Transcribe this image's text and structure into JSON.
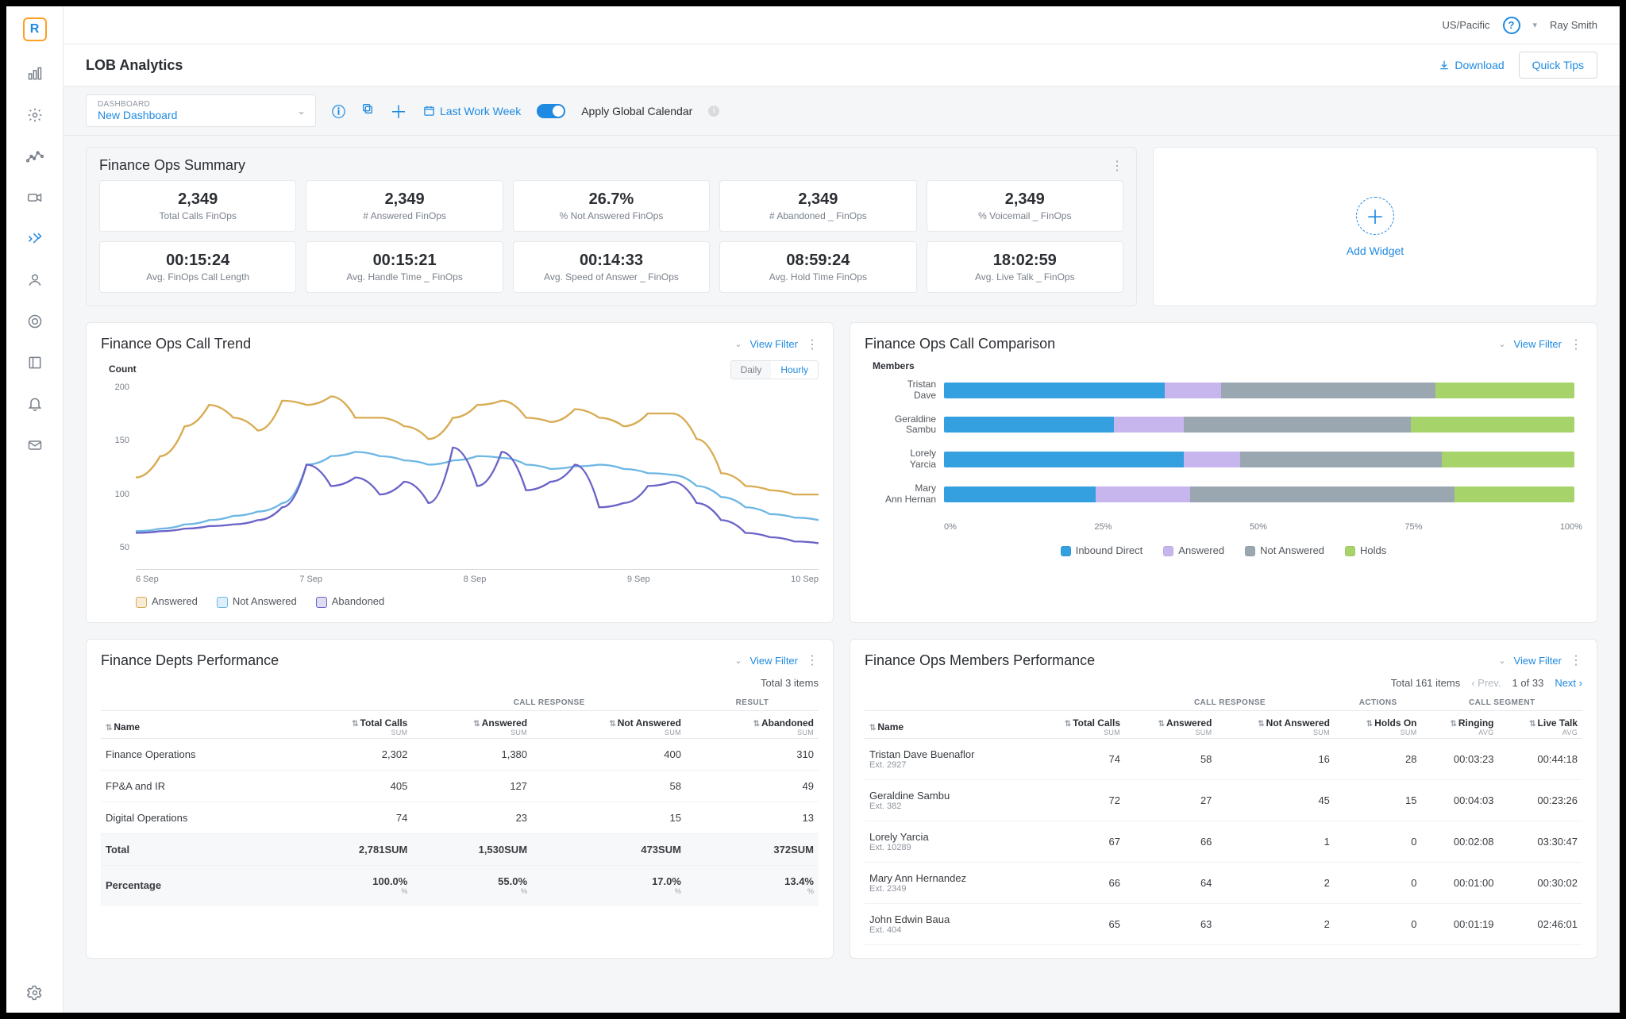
{
  "header": {
    "timezone": "US/Pacific",
    "user": "Ray Smith",
    "page_title": "LOB Analytics",
    "download": "Download",
    "quick_tips": "Quick Tips"
  },
  "toolbar": {
    "dashboard_label": "DASHBOARD",
    "dashboard_value": "New Dashboard",
    "date_label": "Last Work Week",
    "toggle_label": "Apply Global Calendar"
  },
  "add_widget": "Add Widget",
  "summary": {
    "title": "Finance Ops Summary",
    "kpis": [
      {
        "value": "2,349",
        "label": "Total Calls FinOps"
      },
      {
        "value": "2,349",
        "label": "# Answered FinOps"
      },
      {
        "value": "26.7%",
        "label": "% Not Answered FinOps"
      },
      {
        "value": "2,349",
        "label": "# Abandoned _ FinOps"
      },
      {
        "value": "2,349",
        "label": "% Voicemail _ FinOps"
      },
      {
        "value": "00:15:24",
        "label": "Avg. FinOps Call Length"
      },
      {
        "value": "00:15:21",
        "label": "Avg. Handle Time _ FinOps"
      },
      {
        "value": "00:14:33",
        "label": "Avg. Speed of Answer _ FinOps"
      },
      {
        "value": "08:59:24",
        "label": "Avg. Hold Time FinOps"
      },
      {
        "value": "18:02:59",
        "label": "Avg. Live Talk _ FinOps"
      }
    ]
  },
  "trend": {
    "title": "Finance Ops Call Trend",
    "view_filter": "View Filter",
    "ylabel": "Count",
    "daily": "Daily",
    "hourly": "Hourly",
    "legend": [
      "Answered",
      "Not Answered",
      "Abandoned"
    ]
  },
  "compare": {
    "title": "Finance Ops Call Comparison",
    "view_filter": "View Filter",
    "ylabel": "Members",
    "legend": [
      "Inbound Direct",
      "Answered",
      "Not Answered",
      "Holds"
    ]
  },
  "depts": {
    "title": "Finance Depts Performance",
    "view_filter": "View Filter",
    "total_items": "Total 3 items",
    "group_response": "CALL RESPONSE",
    "group_result": "RESULT",
    "cols": {
      "name": "Name",
      "total": "Total Calls",
      "ans": "Answered",
      "nans": "Not Answered",
      "aband": "Abandoned"
    },
    "sub_sum": "SUM",
    "sub_pct": "%",
    "rows": [
      {
        "name": "Finance Operations",
        "total": "2,302",
        "ans": "1,380",
        "nans": "400",
        "aband": "310"
      },
      {
        "name": "FP&A and IR",
        "total": "405",
        "ans": "127",
        "nans": "58",
        "aband": "49"
      },
      {
        "name": "Digital Operations",
        "total": "74",
        "ans": "23",
        "nans": "15",
        "aband": "13"
      }
    ],
    "total_row": {
      "name": "Total",
      "total": "2,781",
      "ans": "1,530",
      "nans": "473",
      "aband": "372"
    },
    "pct_row": {
      "name": "Percentage",
      "total": "100.0%",
      "ans": "55.0%",
      "nans": "17.0%",
      "aband": "13.4%"
    }
  },
  "members": {
    "title": "Finance Ops Members Performance",
    "view_filter": "View Filter",
    "total_items": "Total 161 items",
    "prev": "Prev.",
    "page": "1 of 33",
    "next": "Next",
    "group_response": "CALL RESPONSE",
    "group_actions": "ACTIONS",
    "group_segment": "CALL SEGMENT",
    "cols": {
      "name": "Name",
      "total": "Total Calls",
      "ans": "Answered",
      "nans": "Not Answered",
      "holds": "Holds On",
      "ring": "Ringing",
      "live": "Live Talk"
    },
    "sub_sum": "SUM",
    "sub_avg": "AVG",
    "rows": [
      {
        "name": "Tristan Dave Buenaflor",
        "ext": "Ext. 2927",
        "total": "74",
        "ans": "58",
        "nans": "16",
        "holds": "28",
        "ring": "00:03:23",
        "live": "00:44:18"
      },
      {
        "name": "Geraldine Sambu",
        "ext": "Ext. 382",
        "total": "72",
        "ans": "27",
        "nans": "45",
        "holds": "15",
        "ring": "00:04:03",
        "live": "00:23:26"
      },
      {
        "name": "Lorely Yarcia",
        "ext": "Ext. 10289",
        "total": "67",
        "ans": "66",
        "nans": "1",
        "holds": "0",
        "ring": "00:02:08",
        "live": "03:30:47"
      },
      {
        "name": "Mary Ann Hernandez",
        "ext": "Ext. 2349",
        "total": "66",
        "ans": "64",
        "nans": "2",
        "holds": "0",
        "ring": "00:01:00",
        "live": "00:30:02"
      },
      {
        "name": "John Edwin Baua",
        "ext": "Ext. 404",
        "total": "65",
        "ans": "63",
        "nans": "2",
        "holds": "0",
        "ring": "00:01:19",
        "live": "02:46:01"
      }
    ]
  },
  "chart_data": [
    {
      "type": "line",
      "title": "Finance Ops Call Trend",
      "ylabel": "Count",
      "ylim": [
        0,
        220
      ],
      "x_ticks": [
        "6 Sep",
        "7 Sep",
        "8 Sep",
        "9 Sep",
        "10 Sep"
      ],
      "series": [
        {
          "name": "Answered",
          "color": "#d9ab52",
          "values": [
            105,
            130,
            165,
            190,
            175,
            160,
            195,
            190,
            200,
            175,
            175,
            165,
            150,
            175,
            190,
            195,
            175,
            170,
            185,
            175,
            165,
            180,
            180,
            150,
            110,
            95,
            90,
            85,
            85
          ]
        },
        {
          "name": "Not Answered",
          "color": "#6db7e4",
          "values": [
            42,
            45,
            50,
            55,
            60,
            65,
            75,
            120,
            130,
            135,
            130,
            125,
            120,
            125,
            130,
            128,
            120,
            115,
            118,
            120,
            115,
            110,
            108,
            95,
            82,
            70,
            62,
            58,
            55
          ]
        },
        {
          "name": "Abandoned",
          "color": "#6a63c8",
          "values": [
            40,
            42,
            45,
            48,
            50,
            55,
            70,
            120,
            95,
            105,
            85,
            100,
            75,
            140,
            95,
            135,
            90,
            100,
            120,
            70,
            75,
            95,
            100,
            75,
            55,
            40,
            35,
            30,
            28
          ]
        }
      ]
    },
    {
      "type": "bar",
      "orientation": "horizontal-stacked-100",
      "title": "Finance Ops Call Comparison",
      "x_ticks": [
        "0%",
        "25%",
        "50%",
        "75%",
        "100%"
      ],
      "categories": [
        "Tristan Dave",
        "Geraldine Sambu",
        "Lorely Yarcia",
        "Mary Ann Hernan"
      ],
      "series": [
        {
          "name": "Inbound Direct",
          "color": "#35a0df",
          "values": [
            35,
            27,
            38,
            24
          ]
        },
        {
          "name": "Answered",
          "color": "#c7b6ed",
          "values": [
            9,
            11,
            9,
            15
          ]
        },
        {
          "name": "Not Answered",
          "color": "#9aa7b0",
          "values": [
            34,
            36,
            32,
            42
          ]
        },
        {
          "name": "Holds",
          "color": "#a7d36b",
          "values": [
            22,
            26,
            21,
            19
          ]
        }
      ]
    }
  ]
}
